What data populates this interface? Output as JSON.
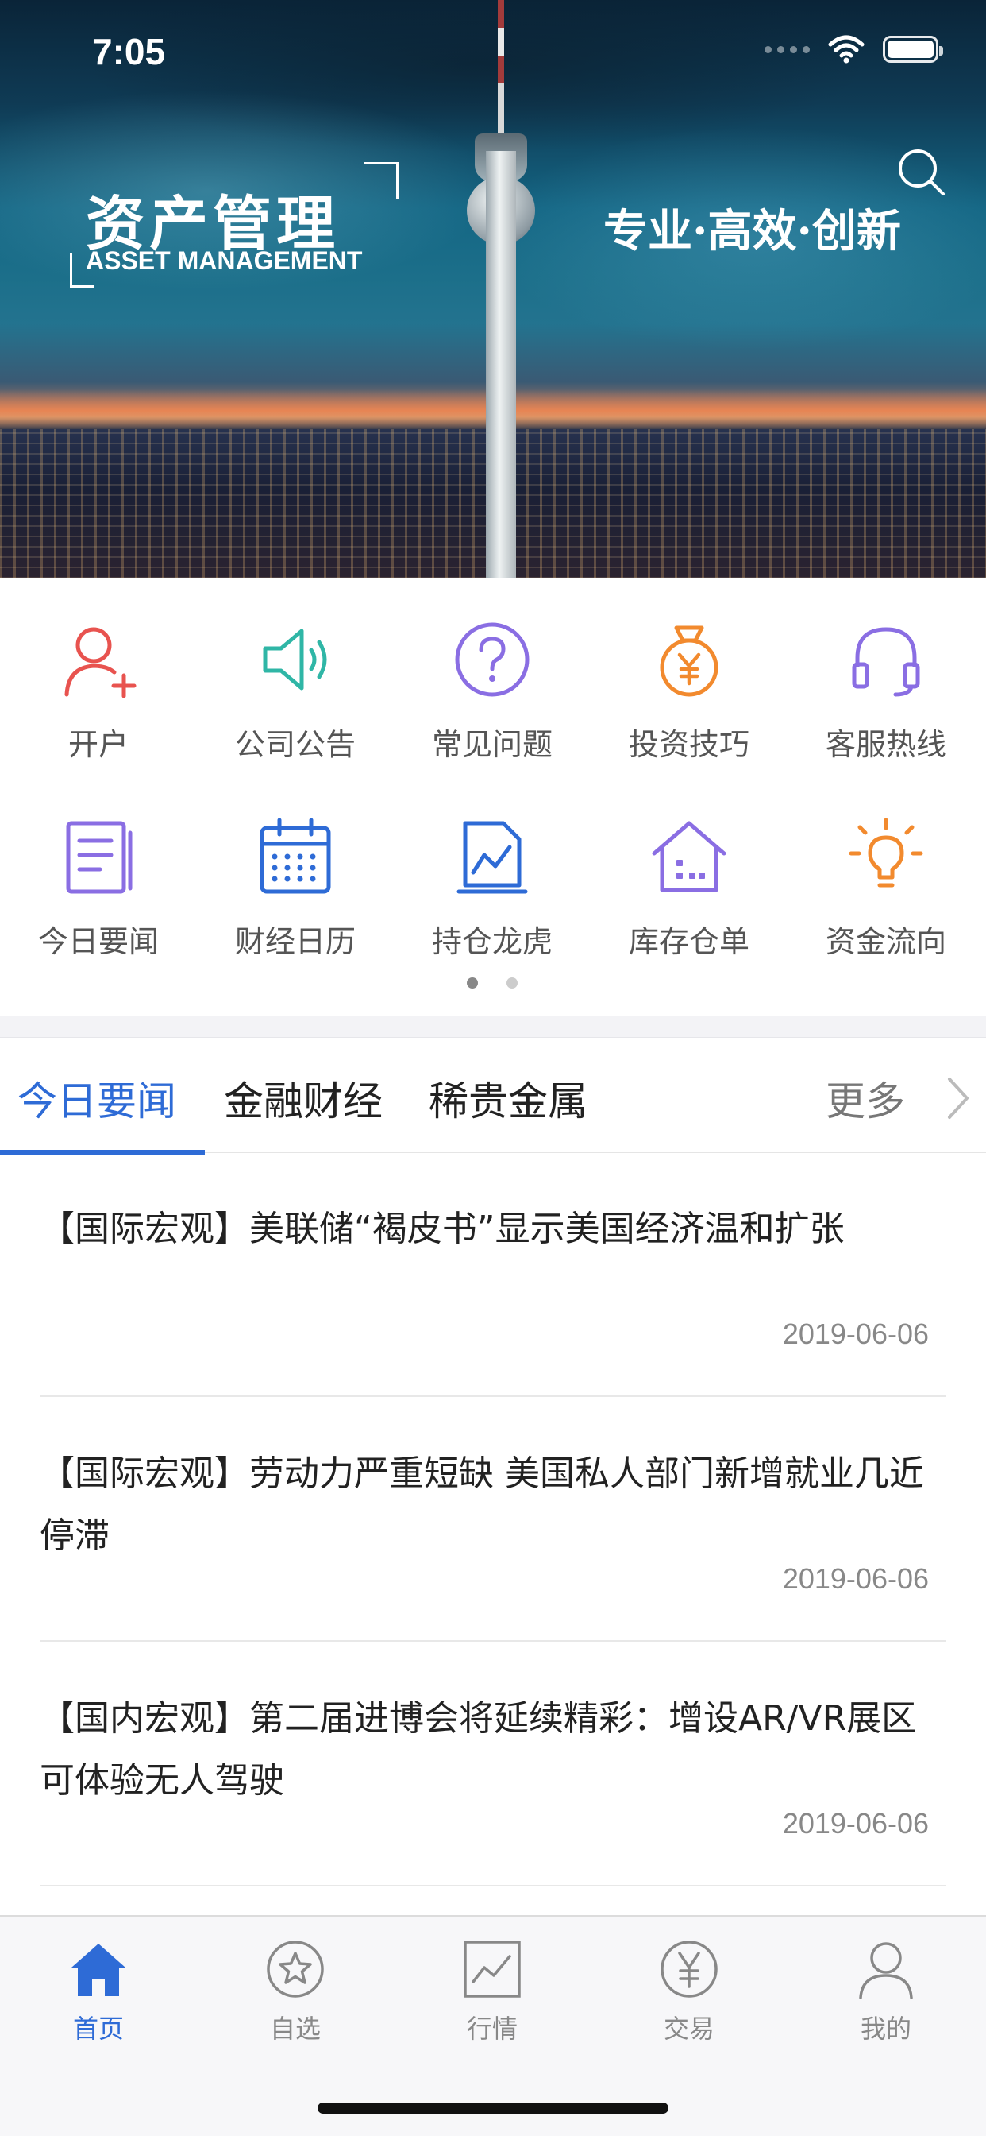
{
  "status_bar": {
    "time": "7:05"
  },
  "banner": {
    "logo_title": "资产管理",
    "logo_subtitle": "ASSET MANAGEMENT",
    "slogan": "专业·高效·创新",
    "search_icon": "search-icon"
  },
  "quick_menu": {
    "items": [
      {
        "label": "开户",
        "icon": "add-user-icon",
        "color": "#e8534f"
      },
      {
        "label": "公司公告",
        "icon": "speaker-icon",
        "color": "#2fb6a6"
      },
      {
        "label": "常见问题",
        "icon": "question-icon",
        "color": "#8a6ee3"
      },
      {
        "label": "投资技巧",
        "icon": "money-bag-icon",
        "color": "#f28a2e"
      },
      {
        "label": "客服热线",
        "icon": "headset-icon",
        "color": "#8a6ee3"
      },
      {
        "label": "今日要闻",
        "icon": "news-icon",
        "color": "#8a6ee3"
      },
      {
        "label": "财经日历",
        "icon": "calendar-icon",
        "color": "#2e6bd6"
      },
      {
        "label": "持仓龙虎",
        "icon": "chart-doc-icon",
        "color": "#2e6bd6"
      },
      {
        "label": "库存仓单",
        "icon": "warehouse-icon",
        "color": "#8a6ee3"
      },
      {
        "label": "资金流向",
        "icon": "lightbulb-icon",
        "color": "#f28a2e"
      }
    ],
    "page_count": 2,
    "current_page": 1
  },
  "news_tabs": {
    "tabs": [
      "今日要闻",
      "金融财经",
      "稀贵金属"
    ],
    "active": 0,
    "more": "更多"
  },
  "news": [
    {
      "title": "【国际宏观】美联储“褐皮书”显示美国经济温和扩张",
      "date": "2019-06-06"
    },
    {
      "title": "【国际宏观】劳动力严重短缺 美国私人部门新增就业几近停滞",
      "date": "2019-06-06"
    },
    {
      "title": "【国内宏观】第二届进博会将延续精彩：增设AR/VR展区 可体验无人驾驶",
      "date": "2019-06-06"
    }
  ],
  "tab_bar": {
    "items": [
      {
        "label": "首页",
        "icon": "home-icon"
      },
      {
        "label": "自选",
        "icon": "star-icon"
      },
      {
        "label": "行情",
        "icon": "chart-icon"
      },
      {
        "label": "交易",
        "icon": "yen-icon"
      },
      {
        "label": "我的",
        "icon": "profile-icon"
      }
    ],
    "active": 0
  },
  "colors": {
    "accent": "#2e6bd6",
    "text": "#222222",
    "muted": "#888888"
  }
}
